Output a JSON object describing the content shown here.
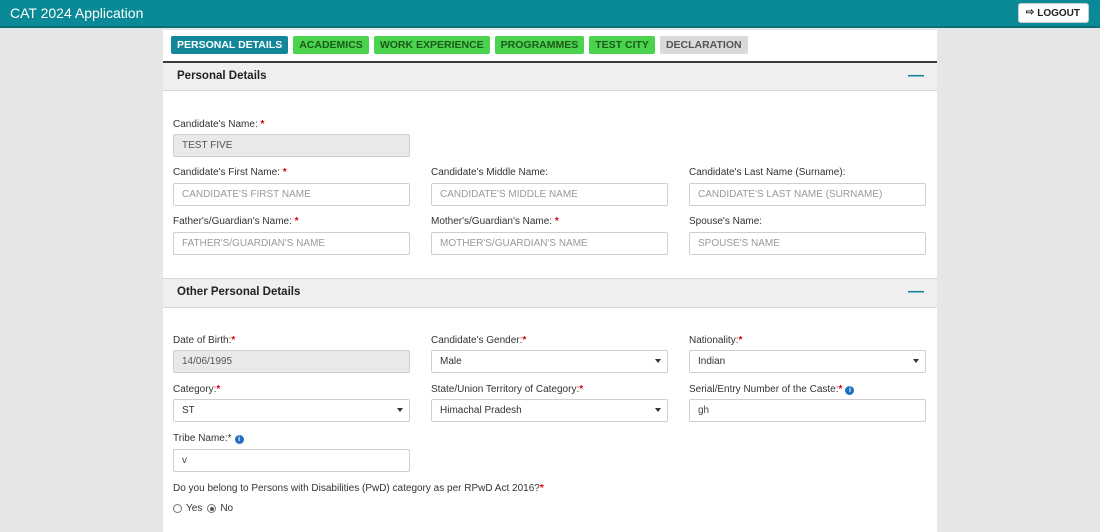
{
  "app": {
    "title": "CAT 2024 Application",
    "logout_label": "LOGOUT"
  },
  "tabs": [
    {
      "label": "PERSONAL DETAILS",
      "state": "active"
    },
    {
      "label": "ACADEMICS",
      "state": "done"
    },
    {
      "label": "WORK EXPERIENCE",
      "state": "done"
    },
    {
      "label": "PROGRAMMES",
      "state": "done"
    },
    {
      "label": "TEST CITY",
      "state": "done"
    },
    {
      "label": "DECLARATION",
      "state": "todo"
    }
  ],
  "personal": {
    "title": "Personal Details",
    "candidate_name": {
      "label": "Candidate's Name:",
      "value": "TEST FIVE"
    },
    "first_name": {
      "label": "Candidate's First Name:",
      "placeholder": "CANDIDATE'S FIRST NAME"
    },
    "middle_name": {
      "label": "Candidate's Middle Name:",
      "placeholder": "CANDIDATE'S MIDDLE NAME"
    },
    "last_name": {
      "label": "Candidate's Last Name (Surname):",
      "placeholder": "CANDIDATE'S LAST NAME (SURNAME)"
    },
    "father_name": {
      "label": "Father's/Guardian's Name:",
      "placeholder": "FATHER'S/GUARDIAN'S NAME"
    },
    "mother_name": {
      "label": "Mother's/Guardian's Name:",
      "placeholder": "MOTHER'S/GUARDIAN'S NAME"
    },
    "spouse_name": {
      "label": "Spouse's Name:",
      "placeholder": "SPOUSE'S NAME"
    }
  },
  "other": {
    "title": "Other Personal Details",
    "dob": {
      "label": "Date of Birth:",
      "value": "14/06/1995"
    },
    "gender": {
      "label": "Candidate's Gender:",
      "value": "Male"
    },
    "nationality": {
      "label": "Nationality:",
      "value": "Indian"
    },
    "category": {
      "label": "Category:",
      "value": "ST"
    },
    "state": {
      "label": "State/Union Territory of Category:",
      "value": "Himachal Pradesh"
    },
    "serial": {
      "label": "Serial/Entry Number of the Caste:",
      "value": "gh"
    },
    "tribe": {
      "label": "Tribe Name:*",
      "value": "v"
    },
    "pwd": {
      "question": "Do you belong to Persons with Disabilities (PwD) category as per RPwD Act 2016?",
      "yes_label": "Yes",
      "no_label": "No",
      "selected": "No"
    }
  },
  "icons": {
    "logout": "logout-icon",
    "collapse": "minus-icon",
    "info": "info-icon",
    "dropdown": "caret-down-icon"
  },
  "colors": {
    "header": "#0a8a96",
    "active_tab": "#13879a",
    "done_tab": "#4cd34e",
    "required": "#e0000f"
  }
}
